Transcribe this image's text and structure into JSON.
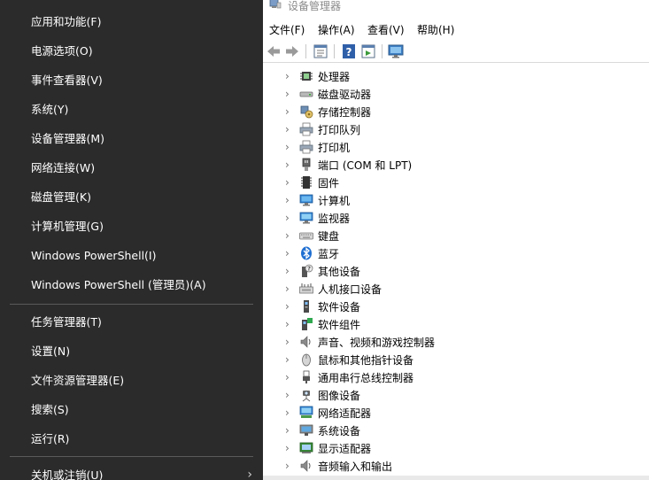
{
  "winx_menu": {
    "items": [
      {
        "label": "应用和功能(F)"
      },
      {
        "label": "电源选项(O)"
      },
      {
        "label": "事件查看器(V)"
      },
      {
        "label": "系统(Y)"
      },
      {
        "label": "设备管理器(M)"
      },
      {
        "label": "网络连接(W)"
      },
      {
        "label": "磁盘管理(K)"
      },
      {
        "label": "计算机管理(G)"
      },
      {
        "label": "Windows PowerShell(I)"
      },
      {
        "label": "Windows PowerShell (管理员)(A)"
      },
      {
        "label": "任务管理器(T)"
      },
      {
        "label": "设置(N)"
      },
      {
        "label": "文件资源管理器(E)"
      },
      {
        "label": "搜索(S)"
      },
      {
        "label": "运行(R)"
      },
      {
        "label": "关机或注销(U)",
        "submenu_arrow": "›"
      }
    ]
  },
  "device_manager": {
    "title": "设备管理器",
    "menu": [
      "文件(F)",
      "操作(A)",
      "查看(V)",
      "帮助(H)"
    ],
    "toolbar": [
      "back-arrow-icon",
      "forward-arrow-icon",
      "properties-icon",
      "help-icon",
      "run-icon",
      "monitor-icon"
    ],
    "tree": [
      {
        "label": "处理器",
        "icon": "processor-icon"
      },
      {
        "label": "磁盘驱动器",
        "icon": "disk-drive-icon"
      },
      {
        "label": "存储控制器",
        "icon": "storage-controller-icon"
      },
      {
        "label": "打印队列",
        "icon": "printer-icon"
      },
      {
        "label": "打印机",
        "icon": "printer-icon"
      },
      {
        "label": "端口 (COM 和 LPT)",
        "icon": "port-icon"
      },
      {
        "label": "固件",
        "icon": "firmware-icon"
      },
      {
        "label": "计算机",
        "icon": "computer-icon"
      },
      {
        "label": "监视器",
        "icon": "monitor-icon"
      },
      {
        "label": "键盘",
        "icon": "keyboard-icon"
      },
      {
        "label": "蓝牙",
        "icon": "bluetooth-icon"
      },
      {
        "label": "其他设备",
        "icon": "other-devices-icon"
      },
      {
        "label": "人机接口设备",
        "icon": "hid-icon"
      },
      {
        "label": "软件设备",
        "icon": "software-device-icon"
      },
      {
        "label": "软件组件",
        "icon": "software-component-icon"
      },
      {
        "label": "声音、视频和游戏控制器",
        "icon": "speaker-icon"
      },
      {
        "label": "鼠标和其他指针设备",
        "icon": "mouse-icon"
      },
      {
        "label": "通用串行总线控制器",
        "icon": "usb-icon"
      },
      {
        "label": "图像设备",
        "icon": "camera-icon"
      },
      {
        "label": "网络适配器",
        "icon": "network-adapter-icon"
      },
      {
        "label": "系统设备",
        "icon": "system-device-icon"
      },
      {
        "label": "显示适配器",
        "icon": "display-adapter-icon"
      },
      {
        "label": "音频输入和输出",
        "icon": "audio-io-icon"
      }
    ]
  }
}
